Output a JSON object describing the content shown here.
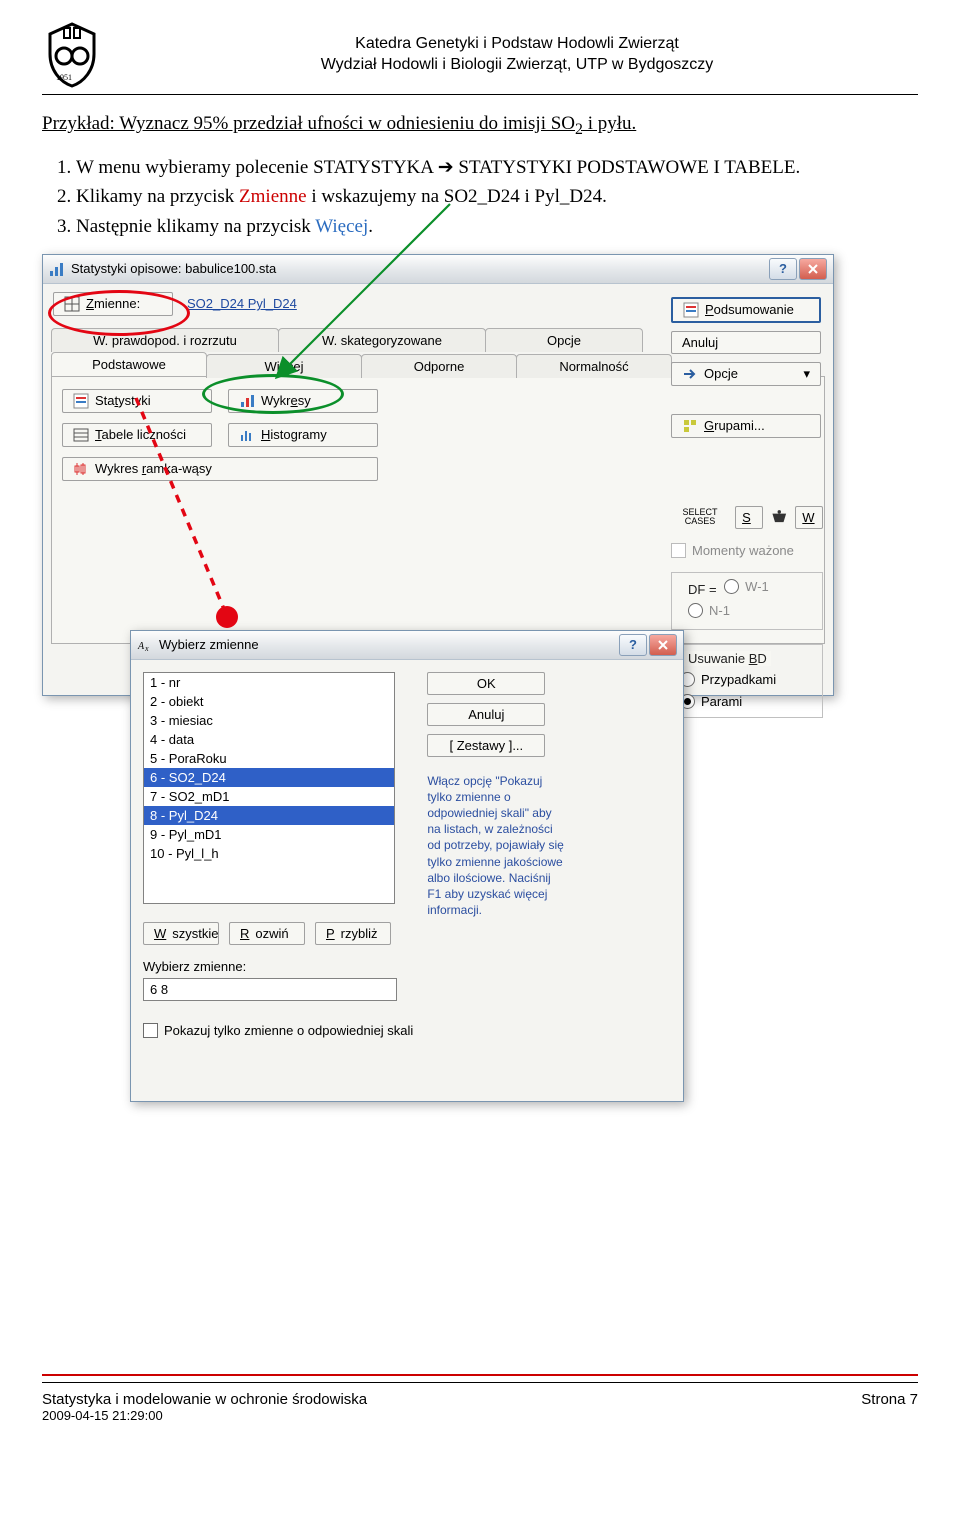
{
  "header": {
    "line1": "Katedra Genetyki i Podstaw Hodowli Zwierząt",
    "line2": "Wydział Hodowli i Biologii Zwierząt, UTP w Bydgoszczy"
  },
  "example": {
    "prefix": "Przykład: Wyznacz 95% przedział ufności w odniesieniu do imisji SO",
    "sub": "2",
    "suffix": " i pyłu."
  },
  "steps": {
    "s1a": "W menu wybieramy polecenie STATYSTYKA ",
    "s1b": " STATYSTYKI PODSTAWOWE I TABELE.",
    "s2a": "Klikamy na przycisk ",
    "s2b": "Zmienne",
    "s2c": " i wskazujemy na SO2_D24 i Pyl_D24.",
    "s3a": "Następnie klikamy na przycisk ",
    "s3b": "Więcej",
    "s3c": "."
  },
  "dlg1": {
    "title": "Statystyki opisowe: babulice100.sta",
    "zmienne_btn": "Zmienne:",
    "vars": "SO2_D24 Pyl_D24",
    "podsumowanie": "Podsumowanie",
    "tabs": {
      "t1": "W. prawdopod. i rozrzutu",
      "t2": "W. skategoryzowane",
      "t3": "Opcje",
      "t4": "Podstawowe",
      "t5": "Więcej",
      "t6": "Odporne",
      "t7": "Normalność"
    },
    "btns": {
      "stat": "Statystyki",
      "wykresy": "Wykresy",
      "tabele": "Tabele liczności",
      "hist": "Histogramy",
      "ramka": "Wykres ramka-wąsy",
      "anuluj": "Anuluj",
      "opcje": "Opcje",
      "grupami": "Grupami..."
    },
    "select_cases": "S",
    "select_cases_label": "SELECT CASES",
    "w_btn": "W",
    "momenty": "Momenty ważone",
    "df": "DF =",
    "df_w1": "W-1",
    "df_n1": "N-1",
    "usuwanie": "Usuwanie BD",
    "przypadkami": "Przypadkami",
    "parami": "Parami"
  },
  "dlg2": {
    "title": "Wybierz zmienne",
    "items": [
      "1 - nr",
      "2 - obiekt",
      "3 - miesiac",
      "4 - data",
      "5 - PoraRoku",
      "6 - SO2_D24",
      "7 - SO2_mD1",
      "8 - Pyl_D24",
      "9 - Pyl_mD1",
      "10 - Pyl_l_h"
    ],
    "ok": "OK",
    "anuluj": "Anuluj",
    "zestawy": "[ Zestawy ]...",
    "wszystkie": "Wszystkie",
    "rozwin": "Rozwiń",
    "przybliz": "Przybliż",
    "label_wybierz": "Wybierz zmienne:",
    "field_val": "6 8",
    "pokazuj": "Pokazuj tylko zmienne o odpowiedniej skali",
    "help": "Włącz opcję \"Pokazuj tylko zmienne o odpowiedniej skali\" aby na listach, w zależności od potrzeby, pojawiały się tylko zmienne jakościowe albo ilościowe. Naciśnij F1 aby uzyskać więcej informacji."
  },
  "footer": {
    "left": "Statystyka i modelowanie w ochronie środowiska",
    "right": "Strona 7",
    "ts": "2009-04-15 21:29:00"
  }
}
